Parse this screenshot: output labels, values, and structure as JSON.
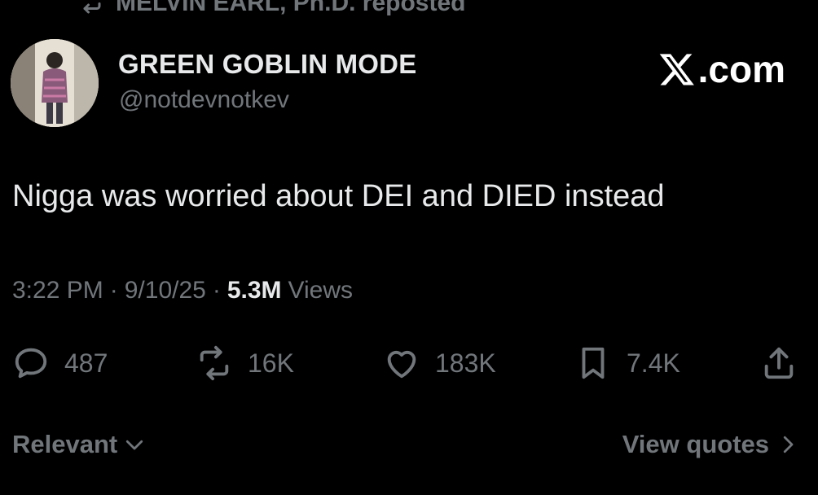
{
  "repost": {
    "text": "MELVIN EARL, Ph.D. reposted",
    "icon": "repost-icon"
  },
  "author": {
    "display_name": "GREEN GOBLIN MODE",
    "handle": "@notdevnotkev",
    "avatar": "avatar-photo"
  },
  "brand": {
    "label": ".com",
    "icon": "x-logo-icon"
  },
  "tweet": {
    "text": "Nigga was worried about DEI and DIED instead"
  },
  "meta": {
    "time": "3:22 PM",
    "separator": "·",
    "date": "9/10/25",
    "views_count": "5.3M",
    "views_label": "Views"
  },
  "actions": {
    "replies": "487",
    "reposts": "16K",
    "likes": "183K",
    "bookmarks": "7.4K"
  },
  "footer": {
    "sort_label": "Relevant",
    "quotes_label": "View quotes"
  },
  "colors": {
    "background": "#000000",
    "primary_text": "#e7e9ea",
    "secondary_text": "#71767b"
  }
}
